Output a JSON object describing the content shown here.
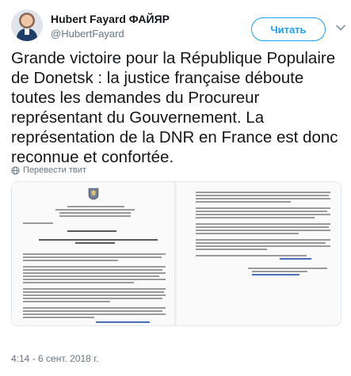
{
  "user": {
    "name": "Hubert Fayard ФАЙЯР",
    "handle": "@HubertFayard"
  },
  "follow_label": "Читать",
  "tweet": {
    "text": "Grande victoire pour la République Populaire de Donetsk : la justice française déboute toutes les demandes du Procureur représentant du Gouvernement. La représentation de la DNR en France est donc reconnue et confortée.",
    "translate_label": "Перевести твит",
    "timestamp": "4:14 - 6 сент. 2018 г."
  },
  "colors": {
    "accent": "#1da1f2",
    "secondary_text": "#657786",
    "primary_text": "#14171a"
  },
  "icons": {
    "follow_menu": "chevron-down-icon",
    "translate": "globe-icon",
    "document": "coat-of-arms-icon"
  }
}
